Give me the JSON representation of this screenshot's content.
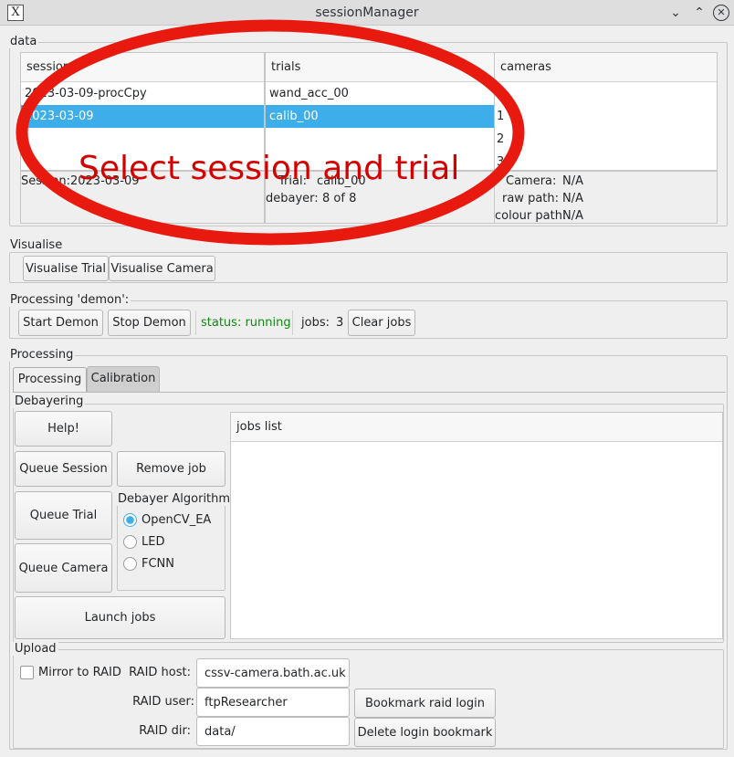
{
  "window": {
    "title": "sessionManager",
    "app_icon": "X"
  },
  "data_group": {
    "label": "data",
    "sessions": {
      "header": "sessions",
      "rows": [
        "2023-03-09-procCpy",
        "2023-03-09"
      ],
      "selected": 1
    },
    "trials": {
      "header": "trials",
      "rows": [
        "wand_acc_00",
        "calib_00"
      ],
      "selected": 1
    },
    "cameras": {
      "header": "cameras",
      "rows": [
        "0",
        "1",
        "2",
        "3"
      ]
    },
    "info": {
      "session": "Session:2023-03-09",
      "trial_label": "Trial:",
      "trial_value": "calib_00",
      "debayer_label": "debayer:",
      "debayer_value": "8 of 8",
      "camera_label": "Camera:",
      "camera_value": "N/A",
      "raw_label": "raw path:",
      "raw_value": "N/A",
      "colour_label": "colour path:",
      "colour_value": "N/A"
    }
  },
  "annotation": {
    "text": "Select session and trial",
    "color": "#e00000"
  },
  "visualise": {
    "label": "Visualise",
    "trial_btn": "Visualise Trial",
    "camera_btn": "Visualise Camera"
  },
  "demon": {
    "label": "Processing 'demon':",
    "start_btn": "Start Demon",
    "stop_btn": "Stop Demon",
    "status": "status: running",
    "status_color": "#118811",
    "jobs_label": "jobs:",
    "jobs_count": "3",
    "clear_btn": "Clear jobs"
  },
  "processing": {
    "label": "Processing",
    "tabs": [
      "Processing",
      "Calibration"
    ],
    "debayering": {
      "label": "Debayering",
      "help_btn": "Help!",
      "queue_session_btn": "Queue Session",
      "remove_job_btn": "Remove job",
      "queue_trial_btn": "Queue Trial",
      "queue_camera_btn": "Queue Camera",
      "launch_btn": "Launch jobs",
      "algo_label": "Debayer Algorithm",
      "algos": [
        "OpenCV_EA",
        "LED",
        "FCNN"
      ],
      "algo_selected": 0,
      "jobs_list_header": "jobs list"
    },
    "upload": {
      "label": "Upload",
      "mirror_label": "Mirror to RAID",
      "host_label": "RAID host:",
      "host_value": "cssv-camera.bath.ac.uk",
      "user_label": "RAID user:",
      "user_value": "ftpResearcher",
      "dir_label": "RAID dir:",
      "dir_value": "data/",
      "bookmark_btn": "Bookmark raid login",
      "delete_bookmark_btn": "Delete login bookmark"
    }
  }
}
